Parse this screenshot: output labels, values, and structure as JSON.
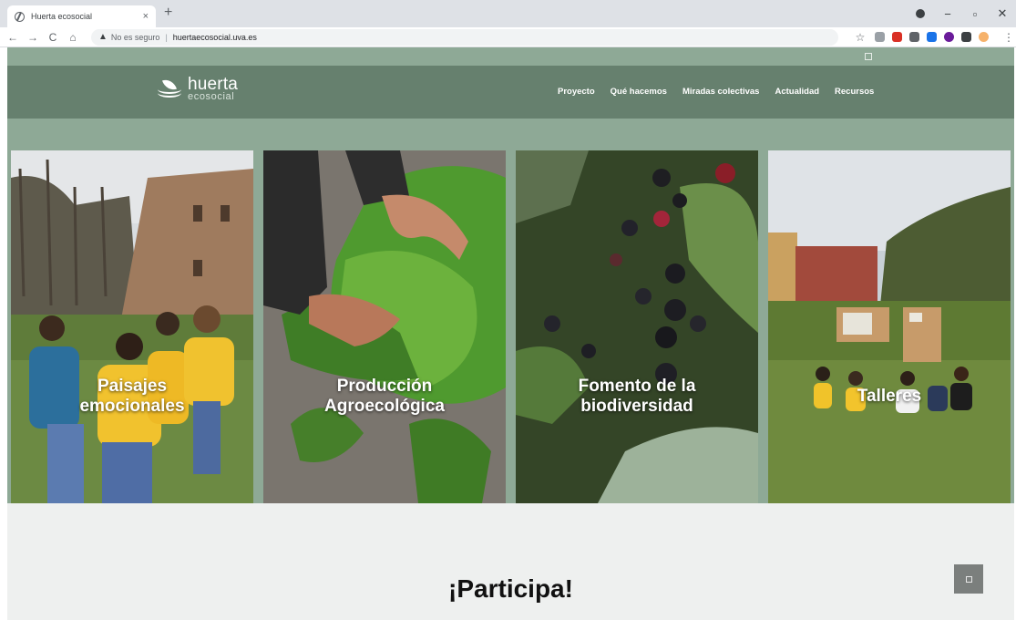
{
  "browser": {
    "tab_title": "Huerta ecosocial",
    "tab_close": "×",
    "new_tab": "+",
    "security_label": "No es seguro",
    "url": "huertaecosocial.uva.es",
    "back": "←",
    "forward": "→",
    "reload": "C",
    "home": "⌂",
    "star": "☆",
    "menu": "⋮",
    "win_minimize": "−",
    "win_restore": "▫",
    "win_close": "✕"
  },
  "site": {
    "logo_word1": "huerta",
    "logo_word2": "ecosocial",
    "nav": [
      "Proyecto",
      "Qué hacemos",
      "Miradas colectivas",
      "Actualidad",
      "Recursos"
    ],
    "cards": [
      "Paisajes\nemocionales",
      "Producción\nAgroecológica",
      "Fomento de la\nbiodiversidad",
      "Talleres"
    ],
    "participa": "¡Participa!"
  },
  "colors": {
    "header": "#66806e",
    "band": "#8ea996",
    "page_bg": "#eef0ef"
  }
}
